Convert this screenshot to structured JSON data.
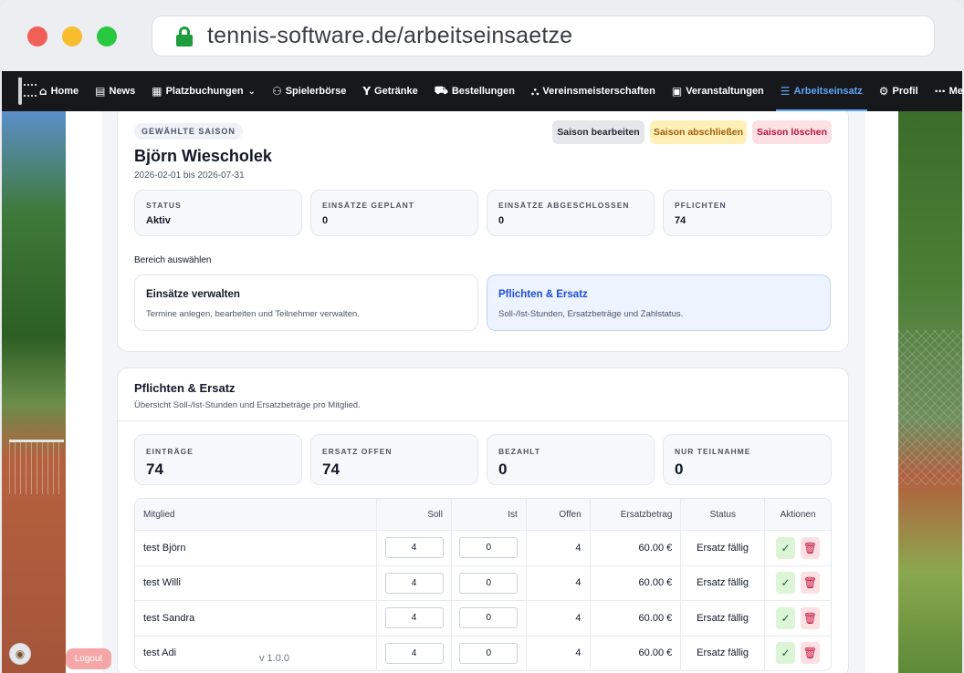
{
  "browser": {
    "url": "tennis-software.de/arbeitseinsaetze"
  },
  "nav": {
    "items": [
      {
        "label": "Home",
        "icon": "home-icon",
        "glyph": "⌂"
      },
      {
        "label": "News",
        "icon": "newspaper-icon",
        "glyph": "▤"
      },
      {
        "label": "Platzbuchungen",
        "icon": "calendar-icon",
        "glyph": "▦",
        "caret": "⌄"
      },
      {
        "label": "Spielerbörse",
        "icon": "users-icon",
        "glyph": "⚇"
      },
      {
        "label": "Getränke",
        "icon": "cocktail-icon",
        "glyph": "Y"
      },
      {
        "label": "Bestellungen",
        "icon": "cart-icon",
        "glyph": "⛟"
      },
      {
        "label": "Vereinsmeisterschaften",
        "icon": "bracket-icon",
        "glyph": "⛬"
      },
      {
        "label": "Veranstaltungen",
        "icon": "calendar-day-icon",
        "glyph": "▣"
      },
      {
        "label": "Arbeitseinsatz",
        "icon": "list-check-icon",
        "glyph": "☰",
        "active": true
      },
      {
        "label": "Profil",
        "icon": "user-gear-icon",
        "glyph": "⚙"
      },
      {
        "label": "Mehr",
        "icon": "ellipsis-icon",
        "glyph": "⋯",
        "caret": "⌄"
      }
    ]
  },
  "season": {
    "badge": "GEWÄHLTE SAISON",
    "name": "Björn Wiescholek",
    "range": "2026-02-01 bis 2026-07-31",
    "edit_label": "Saison bearbeiten",
    "close_label": "Saison abschließen",
    "delete_label": "Saison löschen",
    "stats": [
      {
        "label": "STATUS",
        "value": "Aktiv"
      },
      {
        "label": "EINSÄTZE GEPLANT",
        "value": "0"
      },
      {
        "label": "EINSÄTZE ABGESCHLOSSEN",
        "value": "0"
      },
      {
        "label": "PFLICHTEN",
        "value": "74"
      }
    ],
    "area_label": "Bereich auswählen",
    "choices": [
      {
        "title": "Einsätze verwalten",
        "desc": "Termine anlegen, bearbeiten und Teilnehmer verwalten."
      },
      {
        "title": "Pflichten & Ersatz",
        "desc": "Soll-/Ist-Stunden, Ersatzbeträge und Zahlstatus."
      }
    ]
  },
  "duties": {
    "title": "Pflichten & Ersatz",
    "subtitle": "Übersicht Soll-/Ist-Stunden und Ersatzbeträge pro Mitglied.",
    "stats": [
      {
        "label": "EINTRÄGE",
        "value": "74"
      },
      {
        "label": "ERSATZ OFFEN",
        "value": "74"
      },
      {
        "label": "BEZAHLT",
        "value": "0"
      },
      {
        "label": "NUR TEILNAHME",
        "value": "0"
      }
    ],
    "table": {
      "headers": {
        "member": "Mitglied",
        "soll": "Soll",
        "ist": "Ist",
        "offen": "Offen",
        "ersatz": "Ersatzbetrag",
        "status": "Status",
        "actions": "Aktionen"
      },
      "rows": [
        {
          "member": "test Björn",
          "soll": "4",
          "ist": "0",
          "offen": "4",
          "ersatz": "60.00 €",
          "status": "Ersatz fällig"
        },
        {
          "member": "test Willi",
          "soll": "4",
          "ist": "0",
          "offen": "4",
          "ersatz": "60.00 €",
          "status": "Ersatz fällig"
        },
        {
          "member": "test Sandra",
          "soll": "4",
          "ist": "0",
          "offen": "4",
          "ersatz": "60.00 €",
          "status": "Ersatz fällig"
        },
        {
          "member": "test Adi",
          "soll": "4",
          "ist": "0",
          "offen": "4",
          "ersatz": "60.00 €",
          "status": "Ersatz fällig"
        }
      ],
      "ok_glyph": "✓",
      "del_glyph": "🗑"
    }
  },
  "footer": {
    "logout_label": "Logout",
    "version": "v 1.0.0",
    "cookie_glyph": "◉"
  },
  "colors": {
    "nav_bg": "#16181c",
    "active": "#60a5fa",
    "accent": "#1d4ed8"
  }
}
